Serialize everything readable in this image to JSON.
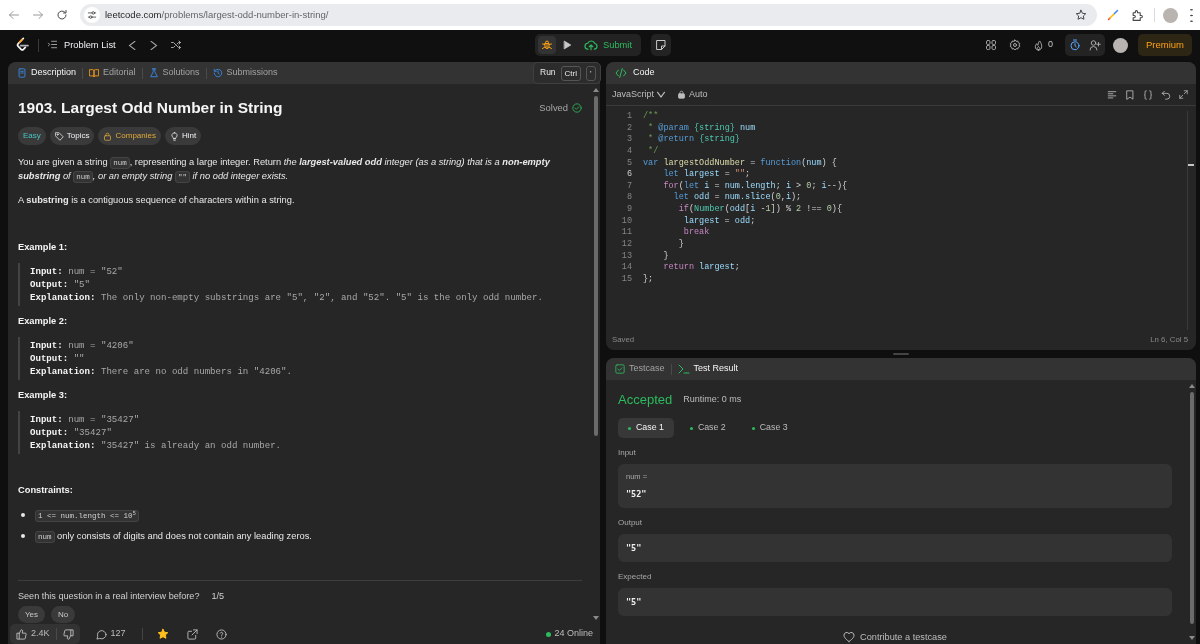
{
  "browser": {
    "url_host": "leetcode.com",
    "url_path": "/problems/largest-odd-number-in-string/"
  },
  "topbar": {
    "problem_list": "Problem List",
    "submit": "Submit",
    "streak": "0",
    "premium": "Premium"
  },
  "tooltip": {
    "label": "Run",
    "keys": [
      "Ctrl",
      "'"
    ]
  },
  "description": {
    "tabs": [
      {
        "label": "Description",
        "kind": "description",
        "selected": true
      },
      {
        "label": "Editorial",
        "kind": "editorial",
        "selected": false
      },
      {
        "label": "Solutions",
        "kind": "solutions",
        "selected": false
      },
      {
        "label": "Submissions",
        "kind": "submissions",
        "selected": false
      }
    ],
    "title": "1903. Largest Odd Number in String",
    "status": "Solved",
    "tags": [
      {
        "label": "Easy",
        "kind": "difficulty"
      },
      {
        "label": "Topics",
        "kind": "topics"
      },
      {
        "label": "Companies",
        "kind": "companies"
      },
      {
        "label": "Hint",
        "kind": "hint"
      }
    ],
    "paragraphs": [
      [
        {
          "kind": "plain",
          "text": "You are given a string "
        },
        {
          "kind": "code",
          "text": "num"
        },
        {
          "kind": "plain",
          "text": ", representing a large integer. Return "
        },
        {
          "kind": "italic",
          "text": "the "
        },
        {
          "kind": "bold_italic",
          "text": "largest-valued odd"
        },
        {
          "kind": "italic",
          "text": " integer (as a string) that is a "
        },
        {
          "kind": "bold_italic",
          "text": "non-empty substring"
        },
        {
          "kind": "italic",
          "text": " of "
        },
        {
          "kind": "code",
          "text": "num"
        },
        {
          "kind": "italic",
          "text": ", or an empty string "
        },
        {
          "kind": "code",
          "text": "\"\""
        },
        {
          "kind": "italic",
          "text": " if no odd integer exists."
        }
      ],
      [
        {
          "kind": "plain",
          "text": "A "
        },
        {
          "kind": "bold",
          "text": "substring"
        },
        {
          "kind": "plain",
          "text": " is a contiguous sequence of characters within a string."
        }
      ]
    ],
    "examples": [
      {
        "title": "Example 1:",
        "lines": [
          {
            "label": "Input:",
            "value": "num = \"52\""
          },
          {
            "label": "Output:",
            "value": "\"5\""
          },
          {
            "label": "Explanation:",
            "value": "The only non-empty substrings are \"5\", \"2\", and \"52\". \"5\" is the only odd number."
          }
        ]
      },
      {
        "title": "Example 2:",
        "lines": [
          {
            "label": "Input:",
            "value": "num = \"4206\""
          },
          {
            "label": "Output:",
            "value": "\"\""
          },
          {
            "label": "Explanation:",
            "value": "There are no odd numbers in \"4206\"."
          }
        ]
      },
      {
        "title": "Example 3:",
        "lines": [
          {
            "label": "Input:",
            "value": "num = \"35427\""
          },
          {
            "label": "Output:",
            "value": "\"35427\""
          },
          {
            "label": "Explanation:",
            "value": "\"35427\" is already an odd number."
          }
        ]
      }
    ],
    "constraints_title": "Constraints:",
    "constraints": [
      [
        {
          "kind": "code",
          "text": "1 <= num.length <= 10$^{5}$"
        }
      ],
      [
        {
          "kind": "code",
          "text": "num"
        },
        {
          "kind": "plain",
          "text": " only consists of digits and does not contain any leading zeros."
        }
      ]
    ],
    "survey": {
      "question": "Seen this question in a real interview before?",
      "counter": "1/5",
      "answers": [
        "Yes",
        "No"
      ]
    },
    "footer": {
      "likes": "2.4K",
      "comments": "127",
      "favorited": true,
      "online": "24 Online"
    }
  },
  "editor": {
    "title": "Code",
    "language": "JavaScript",
    "mode": "Auto",
    "lines": [
      {
        "number": "1",
        "current": false,
        "tokens": [
          {
            "kind": "comment",
            "text": "/**"
          }
        ]
      },
      {
        "number": "2",
        "current": false,
        "tokens": [
          {
            "kind": "comment",
            "text": " * "
          },
          {
            "kind": "doctag",
            "text": "@param"
          },
          {
            "kind": "type",
            "text": " {string}"
          },
          {
            "kind": "variable",
            "text": " num"
          }
        ]
      },
      {
        "number": "3",
        "current": false,
        "tokens": [
          {
            "kind": "comment",
            "text": " * "
          },
          {
            "kind": "doctag",
            "text": "@return"
          },
          {
            "kind": "type",
            "text": " {string}"
          }
        ]
      },
      {
        "number": "4",
        "current": false,
        "tokens": [
          {
            "kind": "comment",
            "text": " */"
          }
        ]
      },
      {
        "number": "5",
        "current": false,
        "tokens": [
          {
            "kind": "keyword",
            "text": "var"
          },
          {
            "kind": "function",
            "text": " largestOddNumber"
          },
          {
            "kind": "plain",
            "text": " = "
          },
          {
            "kind": "keyword",
            "text": "function"
          },
          {
            "kind": "plain",
            "text": "("
          },
          {
            "kind": "variable",
            "text": "num"
          },
          {
            "kind": "plain",
            "text": ") {"
          }
        ]
      },
      {
        "number": "6",
        "current": true,
        "tokens": [
          {
            "kind": "keyword",
            "text": "    let"
          },
          {
            "kind": "variable",
            "text": " largest"
          },
          {
            "kind": "plain",
            "text": " = "
          },
          {
            "kind": "string",
            "text": "\"\""
          },
          {
            "kind": "plain",
            "text": ";"
          }
        ]
      },
      {
        "number": "7",
        "current": false,
        "tokens": [
          {
            "kind": "control",
            "text": "    for"
          },
          {
            "kind": "plain",
            "text": "("
          },
          {
            "kind": "keyword",
            "text": "let"
          },
          {
            "kind": "variable",
            "text": " i"
          },
          {
            "kind": "plain",
            "text": " = "
          },
          {
            "kind": "variable",
            "text": "num.length"
          },
          {
            "kind": "plain",
            "text": "; "
          },
          {
            "kind": "variable",
            "text": "i"
          },
          {
            "kind": "plain",
            "text": " > "
          },
          {
            "kind": "number",
            "text": "0"
          },
          {
            "kind": "plain",
            "text": "; "
          },
          {
            "kind": "variable",
            "text": "i"
          },
          {
            "kind": "plain",
            "text": "--){"
          }
        ]
      },
      {
        "number": "8",
        "current": false,
        "tokens": [
          {
            "kind": "keyword",
            "text": "      let"
          },
          {
            "kind": "variable",
            "text": " odd"
          },
          {
            "kind": "plain",
            "text": " = "
          },
          {
            "kind": "variable",
            "text": "num.slice"
          },
          {
            "kind": "plain",
            "text": "("
          },
          {
            "kind": "number",
            "text": "0"
          },
          {
            "kind": "plain",
            "text": ","
          },
          {
            "kind": "variable",
            "text": "i"
          },
          {
            "kind": "plain",
            "text": ");"
          }
        ]
      },
      {
        "number": "9",
        "current": false,
        "tokens": [
          {
            "kind": "control",
            "text": "       if"
          },
          {
            "kind": "plain",
            "text": "("
          },
          {
            "kind": "type",
            "text": "Number"
          },
          {
            "kind": "plain",
            "text": "("
          },
          {
            "kind": "variable",
            "text": "odd"
          },
          {
            "kind": "plain",
            "text": "["
          },
          {
            "kind": "variable",
            "text": "i"
          },
          {
            "kind": "plain",
            "text": " -"
          },
          {
            "kind": "number",
            "text": "1"
          },
          {
            "kind": "plain",
            "text": "]) % "
          },
          {
            "kind": "number",
            "text": "2"
          },
          {
            "kind": "plain",
            "text": " !== "
          },
          {
            "kind": "number",
            "text": "0"
          },
          {
            "kind": "plain",
            "text": "){"
          }
        ]
      },
      {
        "number": "10",
        "current": false,
        "tokens": [
          {
            "kind": "variable",
            "text": "        largest"
          },
          {
            "kind": "plain",
            "text": " = "
          },
          {
            "kind": "variable",
            "text": "odd"
          },
          {
            "kind": "plain",
            "text": ";"
          }
        ]
      },
      {
        "number": "11",
        "current": false,
        "tokens": [
          {
            "kind": "control",
            "text": "        break"
          }
        ]
      },
      {
        "number": "12",
        "current": false,
        "tokens": [
          {
            "kind": "plain",
            "text": "       }"
          }
        ]
      },
      {
        "number": "13",
        "current": false,
        "tokens": [
          {
            "kind": "plain",
            "text": "    }"
          }
        ]
      },
      {
        "number": "14",
        "current": false,
        "tokens": [
          {
            "kind": "control",
            "text": "    return"
          },
          {
            "kind": "variable",
            "text": " largest"
          },
          {
            "kind": "plain",
            "text": ";"
          }
        ]
      },
      {
        "number": "15",
        "current": false,
        "tokens": [
          {
            "kind": "plain",
            "text": "};"
          }
        ]
      }
    ],
    "save_state": "Saved",
    "cursor": "Ln 6, Col 5"
  },
  "result": {
    "tabs": [
      {
        "label": "Testcase",
        "kind": "testcase",
        "selected": false
      },
      {
        "label": "Test Result",
        "kind": "result",
        "selected": true
      }
    ],
    "verdict": "Accepted",
    "runtime": "Runtime: 0 ms",
    "cases": [
      {
        "label": "Case 1",
        "selected": true,
        "passed": true
      },
      {
        "label": "Case 2",
        "selected": false,
        "passed": true
      },
      {
        "label": "Case 3",
        "selected": false,
        "passed": true
      }
    ],
    "sections": [
      {
        "label": "Input",
        "name": "num =",
        "value": "\"52\""
      },
      {
        "label": "Output",
        "value": "\"5\""
      },
      {
        "label": "Expected",
        "value": "\"5\""
      }
    ],
    "contribute": "Contribute a testcase"
  }
}
